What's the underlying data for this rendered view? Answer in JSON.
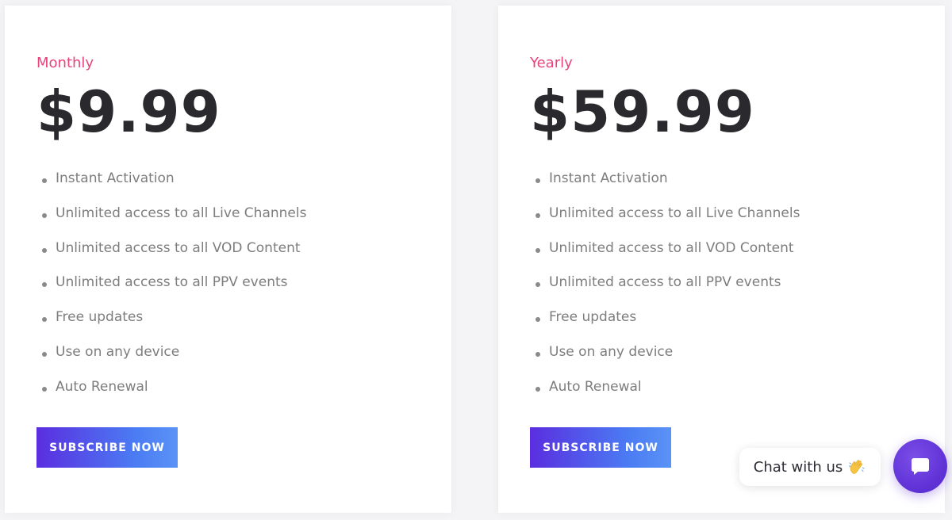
{
  "plans": [
    {
      "name": "Monthly",
      "price": "$9.99",
      "features": [
        "Instant Activation",
        "Unlimited access to all Live Channels",
        "Unlimited access to all VOD Content",
        "Unlimited access to all PPV events",
        "Free updates",
        "Use on any device",
        "Auto Renewal"
      ],
      "button_label": "SUBSCRIBE NOW"
    },
    {
      "name": "Yearly",
      "price": "$59.99",
      "features": [
        "Instant Activation",
        "Unlimited access to all Live Channels",
        "Unlimited access to all VOD Content",
        "Unlimited access to all PPV events",
        "Free updates",
        "Use on any device",
        "Auto Renewal"
      ],
      "button_label": "SUBSCRIBE NOW"
    }
  ],
  "chat": {
    "bubble_text": "Chat with us",
    "bubble_icon": "waving-hand-icon",
    "launcher_icon": "chat-icon"
  },
  "colors": {
    "plan_name": "#e8437a",
    "price": "#2a2a2e",
    "feature_text": "#7d7d7d",
    "button_gradient_start": "#5a2ee0",
    "button_gradient_end": "#5a93f6",
    "chat_launcher": "#6234d8"
  }
}
